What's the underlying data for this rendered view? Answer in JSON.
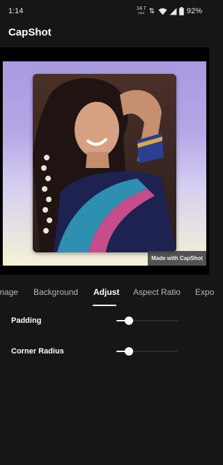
{
  "status_bar": {
    "time": "1:14",
    "net_speed_value": "14.7",
    "net_speed_unit": "KB/S",
    "data_arrows": "⇅",
    "battery_percent": "92%",
    "icons": [
      "wifi-icon",
      "signal-icon",
      "battery-icon"
    ]
  },
  "app": {
    "title": "CapShot"
  },
  "preview": {
    "background_gradient": [
      "#a99ae0",
      "#b5a7e6",
      "#d6cff0",
      "#f4f2d6"
    ],
    "watermark": "Made with CapShot"
  },
  "tabs": [
    {
      "label": "mage",
      "active": false
    },
    {
      "label": "Background",
      "active": false
    },
    {
      "label": "Adjust",
      "active": true
    },
    {
      "label": "Aspect Ratio",
      "active": false
    },
    {
      "label": "Expo",
      "active": false
    }
  ],
  "adjust": {
    "padding": {
      "label": "Padding",
      "value": 0.2
    },
    "corner_radius": {
      "label": "Corner Radius",
      "value": 0.2
    }
  },
  "colors": {
    "background": "#161616",
    "accent": "#ffffff",
    "inactive_tab": "#b8b8b8",
    "slider_track": "#2c2c2c"
  }
}
